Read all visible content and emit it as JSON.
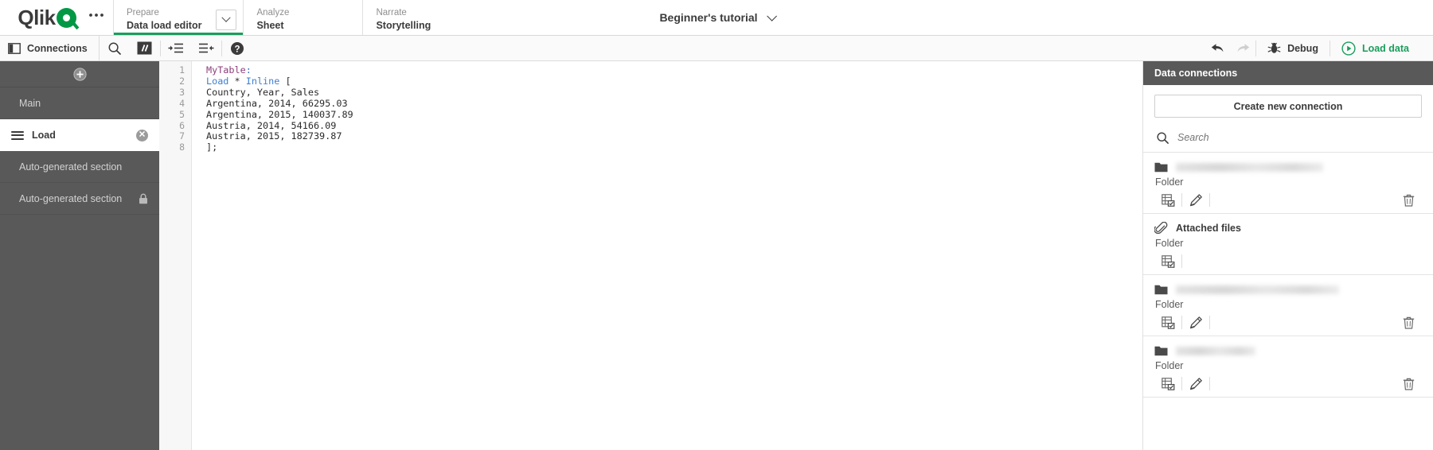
{
  "topbar": {
    "logo": {
      "text": "Qlik",
      "mark_color": "#009845",
      "icon": "qlik-logo"
    },
    "overflow_icon": "ellipsis-icon",
    "tabs": [
      {
        "sup": "Prepare",
        "main": "Data load editor",
        "active": true,
        "has_chevron": true
      },
      {
        "sup": "Analyze",
        "main": "Sheet",
        "active": false,
        "has_chevron": false
      },
      {
        "sup": "Narrate",
        "main": "Storytelling",
        "active": false,
        "has_chevron": false
      }
    ],
    "app_title": "Beginner's tutorial",
    "app_title_chevron": "chevron-down-icon",
    "accent_color": "#1a9d5c"
  },
  "toolbar": {
    "connections_label": "Connections",
    "connections_icon": "panel-toggle-icon",
    "buttons": [
      {
        "name": "search-icon",
        "label": ""
      },
      {
        "name": "comment-icon",
        "label": "//"
      },
      {
        "name": "indent-icon",
        "label": ""
      },
      {
        "name": "outdent-icon",
        "label": ""
      },
      {
        "name": "help-icon",
        "label": "?"
      }
    ],
    "undo_icon": "undo-icon",
    "redo_icon": "redo-icon",
    "debug_label": "Debug",
    "debug_icon": "bug-icon",
    "load_data_label": "Load data",
    "load_data_icon": "play-circle-icon",
    "load_data_color": "#1a9d5c"
  },
  "sidebar": {
    "add_icon": "add-section-icon",
    "sections": [
      {
        "label": "Main",
        "selected": false,
        "locked": false,
        "deletable": false
      },
      {
        "label": "Load",
        "selected": true,
        "locked": false,
        "deletable": true
      },
      {
        "label": "Auto-generated section",
        "selected": false,
        "locked": false,
        "deletable": false
      },
      {
        "label": "Auto-generated section",
        "selected": false,
        "locked": true,
        "deletable": false
      }
    ]
  },
  "editor": {
    "line_numbers": [
      "1",
      "2",
      "3",
      "4",
      "5",
      "6",
      "7",
      "8"
    ],
    "lines": [
      {
        "segments": [
          {
            "text": "MyTable",
            "tok": "tok-table"
          },
          {
            "text": ":",
            "tok": "tok-colon"
          }
        ]
      },
      {
        "segments": [
          {
            "text": "Load",
            "tok": "tok-kw"
          },
          {
            "text": " * ",
            "tok": ""
          },
          {
            "text": "Inline",
            "tok": "tok-kw"
          },
          {
            "text": " [",
            "tok": ""
          }
        ]
      },
      {
        "segments": [
          {
            "text": "Country, Year, Sales",
            "tok": ""
          }
        ]
      },
      {
        "segments": [
          {
            "text": "Argentina, 2014, 66295.03",
            "tok": ""
          }
        ]
      },
      {
        "segments": [
          {
            "text": "Argentina, 2015, 140037.89",
            "tok": ""
          }
        ]
      },
      {
        "segments": [
          {
            "text": "Austria, 2014, 54166.09",
            "tok": ""
          }
        ]
      },
      {
        "segments": [
          {
            "text": "Austria, 2015, 182739.87",
            "tok": ""
          }
        ]
      },
      {
        "segments": [
          {
            "text": "];",
            "tok": ""
          }
        ]
      }
    ]
  },
  "right_panel": {
    "title": "Data connections",
    "create_button": "Create new connection",
    "search_placeholder": "Search",
    "search_value": "",
    "search_icon": "search-icon",
    "connections": [
      {
        "name": "",
        "name_blurred": true,
        "blur_width": 185,
        "type": "Folder",
        "icon": "folder-icon",
        "actions": [
          "select-data-icon",
          "edit-icon",
          "delete-icon"
        ]
      },
      {
        "name": "Attached files",
        "name_blurred": false,
        "blur_width": 0,
        "type": "Folder",
        "icon": "paperclip-icon",
        "actions": [
          "select-data-icon"
        ]
      },
      {
        "name": "",
        "name_blurred": true,
        "blur_width": 205,
        "type": "Folder",
        "icon": "folder-icon",
        "actions": [
          "select-data-icon",
          "edit-icon",
          "delete-icon"
        ]
      },
      {
        "name": "",
        "name_blurred": true,
        "blur_width": 100,
        "type": "Folder",
        "icon": "folder-icon",
        "actions": [
          "select-data-icon",
          "edit-icon",
          "delete-icon"
        ]
      }
    ]
  }
}
